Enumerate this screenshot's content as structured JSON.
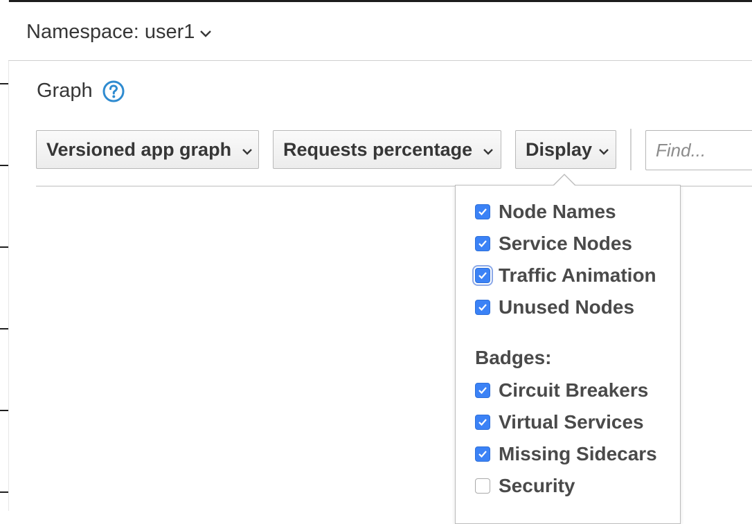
{
  "namespace": {
    "label": "Namespace: user1"
  },
  "page": {
    "title": "Graph"
  },
  "toolbar": {
    "graph_type": "Versioned app graph",
    "edge_label": "Requests percentage",
    "display": "Display",
    "find_placeholder": "Find..."
  },
  "display_menu": {
    "options": [
      {
        "label": "Node Names",
        "checked": true
      },
      {
        "label": "Service Nodes",
        "checked": true
      },
      {
        "label": "Traffic Animation",
        "checked": true
      },
      {
        "label": "Unused Nodes",
        "checked": true
      }
    ],
    "badges_label": "Badges:",
    "badges": [
      {
        "label": "Circuit Breakers",
        "checked": true
      },
      {
        "label": "Virtual Services",
        "checked": true
      },
      {
        "label": "Missing Sidecars",
        "checked": true
      },
      {
        "label": "Security",
        "checked": false
      }
    ]
  },
  "colors": {
    "accent": "#3b82f6",
    "help": "#2f8bd0"
  },
  "icons": [
    "chevron-down-icon",
    "help-icon",
    "check-icon"
  ]
}
